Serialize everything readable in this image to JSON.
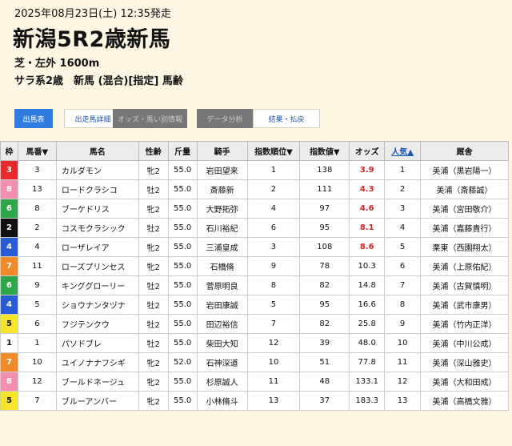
{
  "header": {
    "date": "2025年08月23日(土) 12:35発走",
    "title": "新潟5R2歳新馬",
    "course": "芝・左外 1600m",
    "conditions": "サラ系2歳　新馬 (混合)[指定] 馬齢"
  },
  "tabs": [
    {
      "label": "出馬表",
      "style": "active"
    },
    {
      "label": "出走馬詳細",
      "style": "normal"
    },
    {
      "label": "オッズ・馬い別情報",
      "style": "gray"
    },
    {
      "label": "データ分析",
      "style": "gray"
    },
    {
      "label": "結果・払戻",
      "style": "normal"
    }
  ],
  "table": {
    "headers": [
      "枠",
      "馬番▼",
      "馬名",
      "性齢",
      "斤量",
      "騎手",
      "指数順位▼",
      "指数値▼",
      "オッズ",
      "人気▲",
      "厩舎"
    ],
    "waku_colors": {
      "1": {
        "bg": "#ffffff",
        "fg": "#111111"
      },
      "2": {
        "bg": "#111111",
        "fg": "#ffffff"
      },
      "3": {
        "bg": "#e8292b",
        "fg": "#ffffff"
      },
      "4": {
        "bg": "#2a5bd6",
        "fg": "#ffffff"
      },
      "5": {
        "bg": "#f5e62a",
        "fg": "#111111"
      },
      "6": {
        "bg": "#2fa64a",
        "fg": "#ffffff"
      },
      "7": {
        "bg": "#f08a2a",
        "fg": "#ffffff"
      },
      "8": {
        "bg": "#f08fb0",
        "fg": "#ffffff"
      }
    },
    "rows": [
      {
        "waku": "3",
        "num": "3",
        "name": "カルダモン",
        "sexage": "牝2",
        "weight": "55.0",
        "jockey": "岩田望来",
        "rank": "1",
        "index": "138",
        "odds": "3.9",
        "pop": "1",
        "trainer": "美浦（黒岩陽一）",
        "hi": true
      },
      {
        "waku": "8",
        "num": "13",
        "name": "ロードクラシコ",
        "sexage": "牡2",
        "weight": "55.0",
        "jockey": "斎藤新",
        "rank": "2",
        "index": "111",
        "odds": "4.3",
        "pop": "2",
        "trainer": "美浦（斎藤誠）",
        "hi": true
      },
      {
        "waku": "6",
        "num": "8",
        "name": "ブーケドリス",
        "sexage": "牝2",
        "weight": "55.0",
        "jockey": "大野拓弥",
        "rank": "4",
        "index": "97",
        "odds": "4.6",
        "pop": "3",
        "trainer": "美浦（宮田敬介）",
        "hi": true
      },
      {
        "waku": "2",
        "num": "2",
        "name": "コスモクラシック",
        "sexage": "牡2",
        "weight": "55.0",
        "jockey": "石川裕紀",
        "rank": "6",
        "index": "95",
        "odds": "8.1",
        "pop": "4",
        "trainer": "美浦（嘉藤貴行）",
        "hi": true
      },
      {
        "waku": "4",
        "num": "4",
        "name": "ローザレイア",
        "sexage": "牝2",
        "weight": "55.0",
        "jockey": "三浦皇成",
        "rank": "3",
        "index": "108",
        "odds": "8.6",
        "pop": "5",
        "trainer": "栗東（西園翔太）",
        "hi": true
      },
      {
        "waku": "7",
        "num": "11",
        "name": "ローズプリンセス",
        "sexage": "牝2",
        "weight": "55.0",
        "jockey": "石橋脩",
        "rank": "9",
        "index": "78",
        "odds": "10.3",
        "pop": "6",
        "trainer": "美浦（上原佑紀）",
        "hi": false
      },
      {
        "waku": "6",
        "num": "9",
        "name": "キンググローリー",
        "sexage": "牡2",
        "weight": "55.0",
        "jockey": "菅原明良",
        "rank": "8",
        "index": "82",
        "odds": "14.8",
        "pop": "7",
        "trainer": "美浦（古賀慎明）",
        "hi": false
      },
      {
        "waku": "4",
        "num": "5",
        "name": "ショウナンタヅナ",
        "sexage": "牡2",
        "weight": "55.0",
        "jockey": "岩田康誠",
        "rank": "5",
        "index": "95",
        "odds": "16.6",
        "pop": "8",
        "trainer": "美浦（武市康男）",
        "hi": false
      },
      {
        "waku": "5",
        "num": "6",
        "name": "フジテンクウ",
        "sexage": "牡2",
        "weight": "55.0",
        "jockey": "田辺裕信",
        "rank": "7",
        "index": "82",
        "odds": "25.8",
        "pop": "9",
        "trainer": "美浦（竹内正洋）",
        "hi": false
      },
      {
        "waku": "1",
        "num": "1",
        "name": "パソドブレ",
        "sexage": "牡2",
        "weight": "55.0",
        "jockey": "柴田大知",
        "rank": "12",
        "index": "39",
        "odds": "48.0",
        "pop": "10",
        "trainer": "美浦（中川公成）",
        "hi": false
      },
      {
        "waku": "7",
        "num": "10",
        "name": "ユイノナナフシギ",
        "sexage": "牝2",
        "weight": "52.0",
        "jockey": "石神深道",
        "rank": "10",
        "index": "51",
        "odds": "77.8",
        "pop": "11",
        "trainer": "美浦（深山雅史）",
        "hi": false
      },
      {
        "waku": "8",
        "num": "12",
        "name": "ブールドネージュ",
        "sexage": "牝2",
        "weight": "55.0",
        "jockey": "杉原誠人",
        "rank": "11",
        "index": "48",
        "odds": "133.1",
        "pop": "12",
        "trainer": "美浦（大和田成）",
        "hi": false
      },
      {
        "waku": "5",
        "num": "7",
        "name": "ブルーアンバー",
        "sexage": "牝2",
        "weight": "55.0",
        "jockey": "小林脩斗",
        "rank": "13",
        "index": "37",
        "odds": "183.3",
        "pop": "13",
        "trainer": "美浦（高橋文雅）",
        "hi": false
      }
    ]
  }
}
